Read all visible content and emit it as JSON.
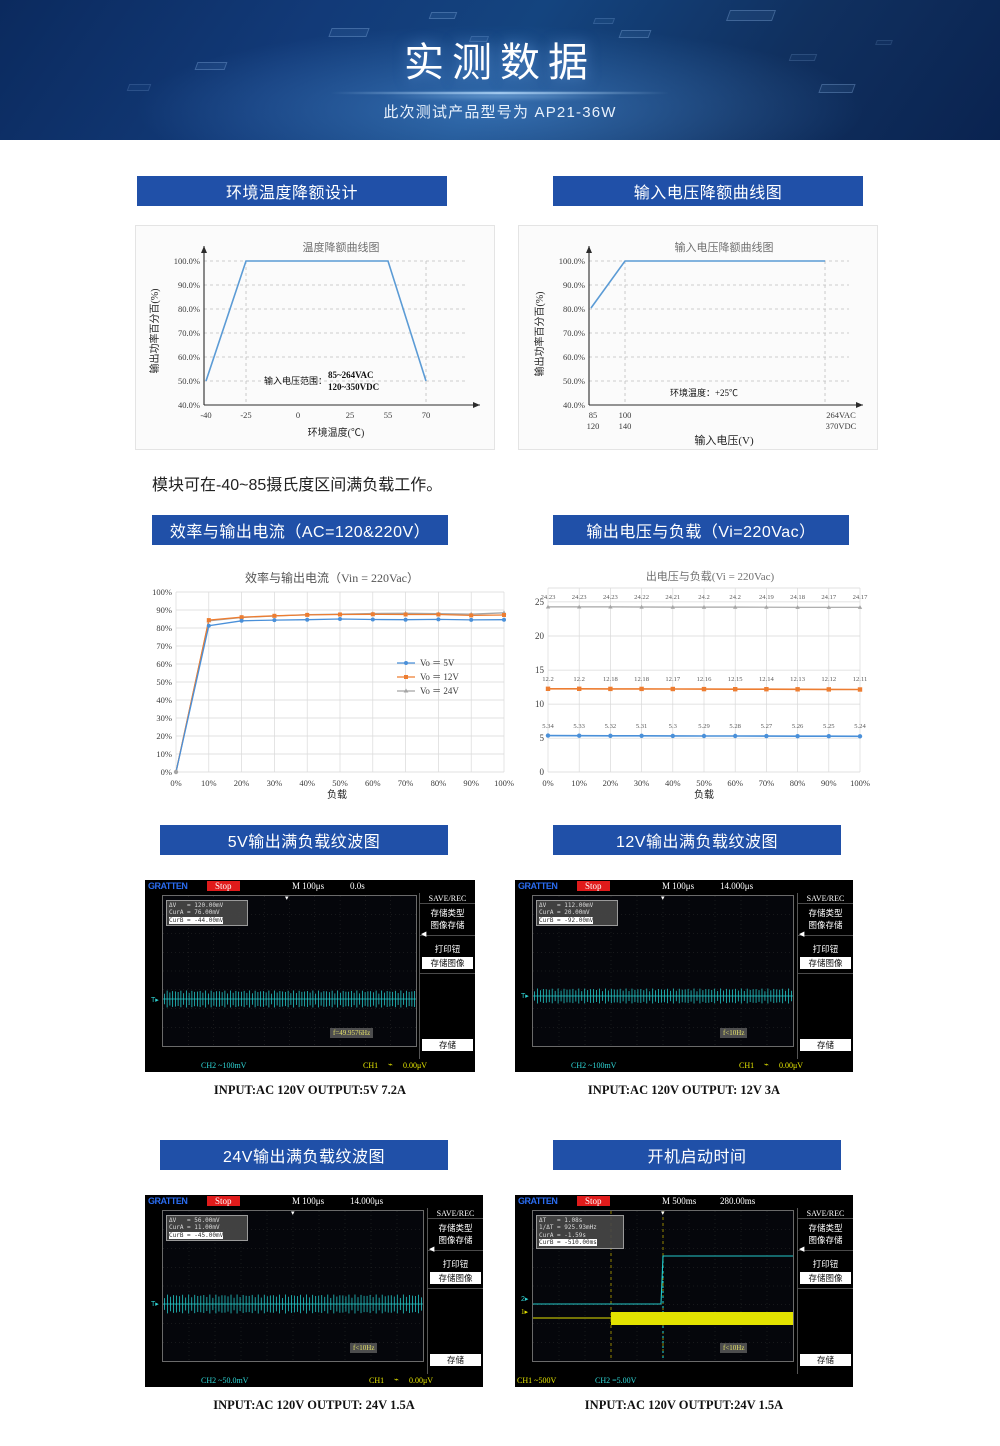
{
  "banner": {
    "title": "实测数据",
    "subtitle": "此次测试产品型号为 AP21-36W"
  },
  "sections": {
    "temp_derating": "环境温度降额设计",
    "input_derating": "输入电压降额曲线图",
    "efficiency": "效率与输出电流（AC=120&220V）",
    "vout_load": "输出电压与负载（Vi=220Vac）",
    "ripple_5v": "5V输出满负载纹波图",
    "ripple_12v": "12V输出满负载纹波图",
    "ripple_24v": "24V输出满负载纹波图",
    "startup": "开机启动时间"
  },
  "note": "模块可在-40~85摄氏度区间满负载工作。",
  "captions": {
    "ripple_5v": "INPUT:AC 120V OUTPUT:5V 7.2A",
    "ripple_12v": "INPUT:AC 120V OUTPUT: 12V 3A",
    "ripple_24v": "INPUT:AC 120V OUTPUT: 24V 1.5A",
    "startup": "INPUT:AC 120V OUTPUT:24V 1.5A"
  },
  "chart_data": [
    {
      "id": "temp_derating",
      "type": "line",
      "title": "温度降额曲线图",
      "xlabel": "环境温度(℃)",
      "ylabel": "输出功率百分百(%)",
      "xticks": [
        "-40",
        "-25",
        "0",
        "25",
        "55",
        "70"
      ],
      "xtickvals": [
        -40,
        -25,
        0,
        25,
        55,
        70
      ],
      "yticks": [
        "40.0%",
        "50.0%",
        "60.0%",
        "70.0%",
        "80.0%",
        "90.0%",
        "100.0%"
      ],
      "ylim": [
        40,
        100
      ],
      "xlim": [
        -40,
        78
      ],
      "grid": true,
      "series": [
        {
          "name": "derating",
          "color": "#5b9bd5",
          "x": [
            -40,
            -25,
            55,
            70
          ],
          "y": [
            50,
            100,
            100,
            50
          ]
        }
      ],
      "annotations": [
        "输入电压范围：",
        "85~264VAC",
        "120~350VDC"
      ]
    },
    {
      "id": "input_derating",
      "type": "line",
      "title": "输入电压降额曲线图",
      "xlabel": "输入电压(V)",
      "ylabel": "输出功率百分百(%)",
      "xticks_ac": [
        "85",
        "100",
        "264VAC"
      ],
      "xticks_dc": [
        "120",
        "140",
        "370VDC"
      ],
      "yticks": [
        "40.0%",
        "50.0%",
        "60.0%",
        "70.0%",
        "80.0%",
        "90.0%",
        "100.0%"
      ],
      "ylim": [
        40,
        100
      ],
      "grid": true,
      "series": [
        {
          "name": "derating",
          "color": "#5b9bd5",
          "x": [
            85,
            100,
            264
          ],
          "y": [
            80.5,
            100,
            100
          ]
        }
      ],
      "annotations": [
        "环境温度：+25℃"
      ]
    },
    {
      "id": "efficiency",
      "type": "line",
      "title": "效率与输出电流（Vin = 220Vac）",
      "xlabel": "负载",
      "ylabel": "",
      "categories": [
        "0%",
        "10%",
        "20%",
        "30%",
        "40%",
        "50%",
        "60%",
        "70%",
        "80%",
        "90%",
        "100%"
      ],
      "yticks": [
        "0%",
        "10%",
        "20%",
        "30%",
        "40%",
        "50%",
        "60%",
        "70%",
        "80%",
        "90%",
        "100%"
      ],
      "ylim": [
        0,
        100
      ],
      "grid": true,
      "legend_position": "right-middle",
      "series": [
        {
          "name": "Vo ＝ 5V",
          "color": "#4a90d9",
          "marker": "diamond",
          "values": [
            0,
            81.3,
            84.0,
            84.4,
            84.6,
            85.0,
            84.7,
            84.6,
            84.8,
            84.5,
            84.6
          ]
        },
        {
          "name": "Vo ＝ 12V",
          "color": "#ed7d31",
          "marker": "square",
          "values": [
            0,
            84.4,
            86.0,
            86.8,
            87.3,
            87.5,
            87.6,
            87.5,
            87.5,
            87.0,
            87.2
          ]
        },
        {
          "name": "Vo ＝ 24V",
          "color": "#a5a5a5",
          "marker": "triangle",
          "values": [
            0,
            84.0,
            86.4,
            87.2,
            88.0,
            88.2,
            88.6,
            88.7,
            88.5,
            88.2,
            89.0
          ]
        }
      ]
    },
    {
      "id": "vout_load",
      "type": "line",
      "title": "出电压与负载(Vi = 220Vac)",
      "xlabel": "负载",
      "ylabel": "",
      "categories": [
        "0%",
        "10%",
        "20%",
        "30%",
        "40%",
        "50%",
        "60%",
        "70%",
        "80%",
        "90%",
        "100%"
      ],
      "yticks": [
        "0",
        "5",
        "10",
        "15",
        "20",
        "25"
      ],
      "ylim": [
        0,
        27
      ],
      "grid": true,
      "series": [
        {
          "name": "24V",
          "color": "#a5a5a5",
          "marker": "triangle",
          "values": [
            24.23,
            24.23,
            24.23,
            24.22,
            24.21,
            24.2,
            24.2,
            24.19,
            24.18,
            24.17,
            24.17
          ],
          "labels": [
            "24.23",
            "24.23",
            "24.23",
            "24.22",
            "24.21",
            "24.2",
            "24.2",
            "24.19",
            "24.18",
            "24.17",
            "24.17"
          ]
        },
        {
          "name": "12V",
          "color": "#ed7d31",
          "marker": "square",
          "values": [
            12.2,
            12.2,
            12.18,
            12.18,
            12.17,
            12.16,
            12.15,
            12.14,
            12.13,
            12.12,
            12.11
          ],
          "labels": [
            "12.2",
            "12.2",
            "12.18",
            "12.18",
            "12.17",
            "12.16",
            "12.15",
            "12.14",
            "12.13",
            "12.12",
            "12.11"
          ]
        },
        {
          "name": "5V",
          "color": "#4a90d9",
          "marker": "diamond",
          "values": [
            5.34,
            5.33,
            5.32,
            5.31,
            5.3,
            5.29,
            5.28,
            5.27,
            5.26,
            5.25,
            5.24
          ],
          "labels": [
            "5.34",
            "5.33",
            "5.32",
            "5.31",
            "5.3",
            "5.29",
            "5.28",
            "5.27",
            "5.26",
            "5.25",
            "5.24"
          ]
        }
      ]
    }
  ],
  "scopes": [
    {
      "id": "ripple_5v",
      "brand": "GRATTEN",
      "status": "Stop",
      "timebase": "M 100μs",
      "delay": "0.0s",
      "meas": [
        "ΔV   = 120.00mV",
        "CurA = 76.00mV",
        "CurB = -44.00mV"
      ],
      "meas_inv_index": 2,
      "fbox": "f=49.9576Hz",
      "menu_header": "SAVE/REC",
      "menu": [
        "存储类型",
        "图像存储",
        "打印钮",
        "存储图像",
        "存储"
      ],
      "menu_selected": [
        "存储图像",
        "存储"
      ],
      "ch_left": "CH2  ~100mV",
      "ch_right": "CH1",
      "trig_level": "0.00μV"
    },
    {
      "id": "ripple_12v",
      "brand": "GRATTEN",
      "status": "Stop",
      "timebase": "M 100μs",
      "delay": "14.000μs",
      "meas": [
        "ΔV   = 112.00mV",
        "CurA = 20.00mV",
        "CurB = -92.00mV"
      ],
      "meas_inv_index": 2,
      "fbox": "f<10Hz",
      "menu_header": "SAVE/REC",
      "menu": [
        "存储类型",
        "图像存储",
        "打印钮",
        "存储图像",
        "存储"
      ],
      "menu_selected": [
        "存储图像",
        "存储"
      ],
      "ch_left": "CH2  ~100mV",
      "ch_right": "CH1",
      "trig_level": "0.00μV"
    },
    {
      "id": "ripple_24v",
      "brand": "GRATTEN",
      "status": "Stop",
      "timebase": "M 100μs",
      "delay": "14.000μs",
      "meas": [
        "ΔV   = 56.00mV",
        "CurA = 11.00mV",
        "CurB = -45.00mV"
      ],
      "meas_inv_index": 2,
      "fbox": "f<10Hz",
      "menu_header": "SAVE/REC",
      "menu": [
        "存储类型",
        "图像存储",
        "打印钮",
        "存储图像",
        "存储"
      ],
      "menu_selected": [
        "存储图像",
        "存储"
      ],
      "ch_left": "CH2  ~50.0mV",
      "ch_right": "CH1",
      "trig_level": "0.00μV"
    },
    {
      "id": "startup",
      "brand": "GRATTEN",
      "status": "Stop",
      "timebase": "M 500ms",
      "delay": "280.00ms",
      "meas": [
        "ΔT   = 1.08s",
        "1/ΔT = 925.93mHz",
        "CurA = -1.59s",
        "CurB = -510.00ms"
      ],
      "meas_inv_index": 3,
      "fbox": "f<10Hz",
      "menu_header": "SAVE/REC",
      "menu": [
        "存储类型",
        "图像存储",
        "打印钮",
        "存储图像",
        "存储"
      ],
      "menu_selected": [
        "存储图像",
        "存储"
      ],
      "ch_left": "CH1  ~500V",
      "ch_left2": "CH2  =5.00V",
      "ch_right": "",
      "trig_level": ""
    }
  ],
  "colors": {
    "banner_blue": "#123a78",
    "header_blue": "#2050a8",
    "series_5v": "#4a90d9",
    "series_12v": "#ed7d31",
    "series_24v": "#a5a5a5",
    "curve_blue": "#5b9bd5"
  }
}
